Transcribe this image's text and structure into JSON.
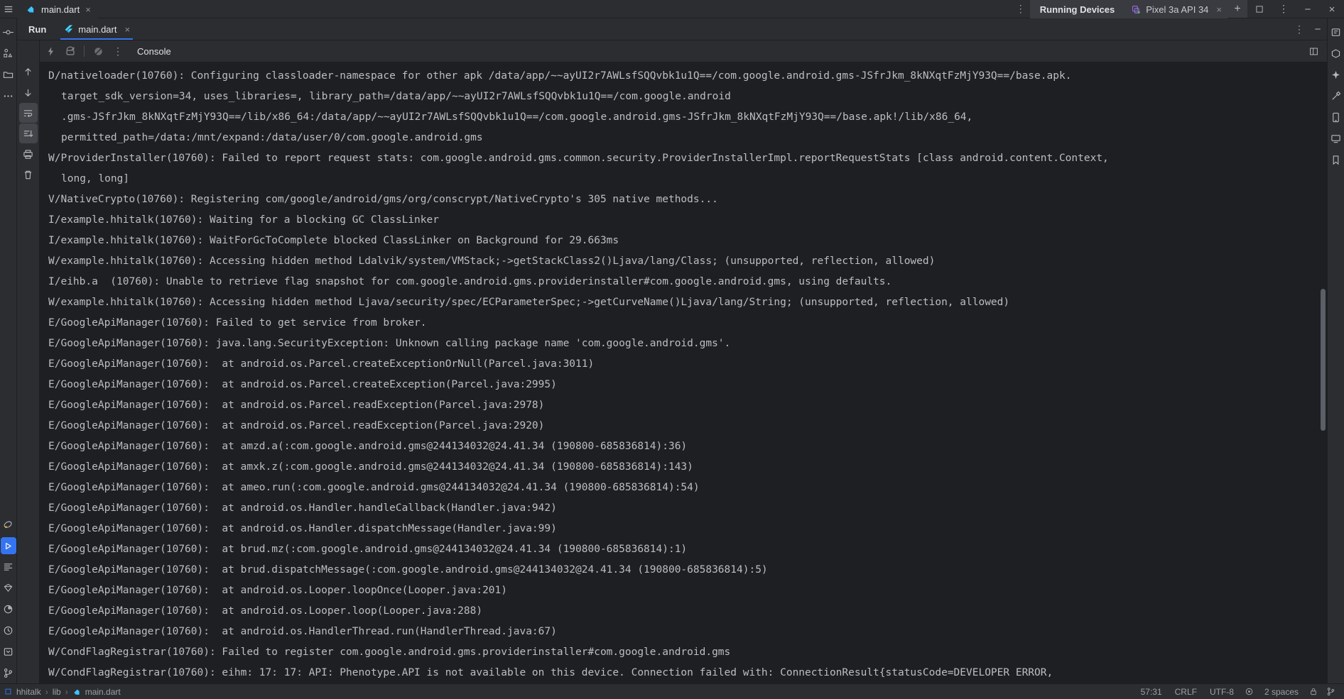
{
  "titlebar": {
    "file_tab": {
      "label": "main.dart",
      "icon": "dart-icon",
      "close": "×"
    },
    "kebab": "⋮",
    "running_devices_label": "Running Devices",
    "device_tab": {
      "label": "Pixel 3a API 34",
      "icon": "device-icon",
      "close": "×"
    },
    "add_device": "+",
    "window_controls": {
      "restore": "❐",
      "more": "⋮",
      "minimize": "─",
      "close": "✕"
    }
  },
  "left_rail": {
    "items": [
      {
        "name": "commit-icon",
        "glyph": "⊖"
      },
      {
        "name": "structure-icon",
        "glyph": "□"
      },
      {
        "name": "project-folder-icon",
        "glyph": "❑"
      },
      {
        "name": "more-tools-icon",
        "glyph": "⋯"
      },
      {
        "name": "device-manager-icon",
        "glyph": "⬚"
      },
      {
        "name": "run-icon",
        "glyph": "▶"
      },
      {
        "name": "terminal-icon",
        "glyph": "≡"
      },
      {
        "name": "flutter-outline-icon",
        "glyph": "◇"
      },
      {
        "name": "profiler-icon",
        "glyph": "◔"
      },
      {
        "name": "todo-icon",
        "glyph": "①"
      },
      {
        "name": "problems-icon",
        "glyph": "⊘"
      },
      {
        "name": "version-control-icon",
        "glyph": "⑂"
      }
    ]
  },
  "right_rail": {
    "items": [
      {
        "name": "notifications-icon",
        "glyph": "☰"
      },
      {
        "name": "gradle-icon",
        "glyph": "⬡"
      },
      {
        "name": "ai-assistant-icon",
        "glyph": "✦"
      },
      {
        "name": "build-icon",
        "glyph": "⚒"
      },
      {
        "name": "device-file-explorer-icon",
        "glyph": "❑"
      },
      {
        "name": "emulator-icon",
        "glyph": "⬛"
      },
      {
        "name": "bookmarks-icon",
        "glyph": "⧉"
      }
    ]
  },
  "run_window": {
    "title": "Run",
    "tab": {
      "label": "main.dart",
      "icon": "flutter-icon",
      "close": "×"
    },
    "settings_icon": "⋮",
    "hide_icon": "─"
  },
  "console_toolbar": {
    "items": [
      {
        "name": "rerun-icon",
        "glyph": "⚡",
        "selected": false
      },
      {
        "name": "hot-reload-icon",
        "glyph": "↺",
        "selected": false
      },
      {
        "name": "stop-icon",
        "glyph": "●",
        "selected": false
      },
      {
        "name": "more-actions-icon",
        "glyph": "⋮",
        "selected": false
      }
    ],
    "console_tab_label": "Console",
    "expand_icon": "❐",
    "side_items": [
      {
        "name": "scroll-up-icon",
        "glyph": "↑",
        "selected": false
      },
      {
        "name": "scroll-down-icon",
        "glyph": "↓",
        "selected": false
      },
      {
        "name": "soft-wrap-icon",
        "glyph": "↵",
        "selected": true
      },
      {
        "name": "scroll-to-end-icon",
        "glyph": "⇣",
        "selected": true
      },
      {
        "name": "print-icon",
        "glyph": "⎙",
        "selected": false
      },
      {
        "name": "clear-all-icon",
        "glyph": "Ὕ1",
        "selected": false
      }
    ]
  },
  "console": {
    "lines": [
      {
        "text": "D/nativeloader(10760): Configuring classloader-namespace for other apk /data/app/~~ayUI2r7AWLsfSQQvbk1u1Q==/com.google.android.gms-JSfrJkm_8kNXqtFzMjY93Q==/base.apk.",
        "cont": false
      },
      {
        "text": "target_sdk_version=34, uses_libraries=, library_path=/data/app/~~ayUI2r7AWLsfSQQvbk1u1Q==/com.google.android",
        "cont": true
      },
      {
        "text": ".gms-JSfrJkm_8kNXqtFzMjY93Q==/lib/x86_64:/data/app/~~ayUI2r7AWLsfSQQvbk1u1Q==/com.google.android.gms-JSfrJkm_8kNXqtFzMjY93Q==/base.apk!/lib/x86_64,",
        "cont": true
      },
      {
        "text": "permitted_path=/data:/mnt/expand:/data/user/0/com.google.android.gms",
        "cont": true
      },
      {
        "text": "W/ProviderInstaller(10760): Failed to report request stats: com.google.android.gms.common.security.ProviderInstallerImpl.reportRequestStats [class android.content.Context,",
        "cont": false
      },
      {
        "text": "long, long]",
        "cont": true
      },
      {
        "text": "V/NativeCrypto(10760): Registering com/google/android/gms/org/conscrypt/NativeCrypto's 305 native methods...",
        "cont": false
      },
      {
        "text": "I/example.hhitalk(10760): Waiting for a blocking GC ClassLinker",
        "cont": false
      },
      {
        "text": "I/example.hhitalk(10760): WaitForGcToComplete blocked ClassLinker on Background for 29.663ms",
        "cont": false
      },
      {
        "text": "W/example.hhitalk(10760): Accessing hidden method Ldalvik/system/VMStack;->getStackClass2()Ljava/lang/Class; (unsupported, reflection, allowed)",
        "cont": false
      },
      {
        "text": "I/eihb.a  (10760): Unable to retrieve flag snapshot for com.google.android.gms.providerinstaller#com.google.android.gms, using defaults.",
        "cont": false
      },
      {
        "text": "W/example.hhitalk(10760): Accessing hidden method Ljava/security/spec/ECParameterSpec;->getCurveName()Ljava/lang/String; (unsupported, reflection, allowed)",
        "cont": false
      },
      {
        "text": "E/GoogleApiManager(10760): Failed to get service from broker.",
        "cont": false
      },
      {
        "text": "E/GoogleApiManager(10760): java.lang.SecurityException: Unknown calling package name 'com.google.android.gms'.",
        "cont": false
      },
      {
        "text": "E/GoogleApiManager(10760):  at android.os.Parcel.createExceptionOrNull(Parcel.java:3011)",
        "cont": false
      },
      {
        "text": "E/GoogleApiManager(10760):  at android.os.Parcel.createException(Parcel.java:2995)",
        "cont": false
      },
      {
        "text": "E/GoogleApiManager(10760):  at android.os.Parcel.readException(Parcel.java:2978)",
        "cont": false
      },
      {
        "text": "E/GoogleApiManager(10760):  at android.os.Parcel.readException(Parcel.java:2920)",
        "cont": false
      },
      {
        "text": "E/GoogleApiManager(10760):  at amzd.a(:com.google.android.gms@244134032@24.41.34 (190800-685836814):36)",
        "cont": false
      },
      {
        "text": "E/GoogleApiManager(10760):  at amxk.z(:com.google.android.gms@244134032@24.41.34 (190800-685836814):143)",
        "cont": false
      },
      {
        "text": "E/GoogleApiManager(10760):  at ameo.run(:com.google.android.gms@244134032@24.41.34 (190800-685836814):54)",
        "cont": false
      },
      {
        "text": "E/GoogleApiManager(10760):  at android.os.Handler.handleCallback(Handler.java:942)",
        "cont": false
      },
      {
        "text": "E/GoogleApiManager(10760):  at android.os.Handler.dispatchMessage(Handler.java:99)",
        "cont": false
      },
      {
        "text": "E/GoogleApiManager(10760):  at brud.mz(:com.google.android.gms@244134032@24.41.34 (190800-685836814):1)",
        "cont": false
      },
      {
        "text": "E/GoogleApiManager(10760):  at brud.dispatchMessage(:com.google.android.gms@244134032@24.41.34 (190800-685836814):5)",
        "cont": false
      },
      {
        "text": "E/GoogleApiManager(10760):  at android.os.Looper.loopOnce(Looper.java:201)",
        "cont": false
      },
      {
        "text": "E/GoogleApiManager(10760):  at android.os.Looper.loop(Looper.java:288)",
        "cont": false
      },
      {
        "text": "E/GoogleApiManager(10760):  at android.os.HandlerThread.run(HandlerThread.java:67)",
        "cont": false
      },
      {
        "text": "W/CondFlagRegistrar(10760): Failed to register com.google.android.gms.providerinstaller#com.google.android.gms",
        "cont": false
      },
      {
        "text": "W/CondFlagRegistrar(10760): eihm: 17: 17: API: Phenotype.API is not available on this device. Connection failed with: ConnectionResult{statusCode=DEVELOPER ERROR,",
        "cont": false
      }
    ]
  },
  "status_bar": {
    "breadcrumb": [
      {
        "label": "hhitalk",
        "icon": "module-icon"
      },
      {
        "label": "lib",
        "icon": ""
      },
      {
        "label": "main.dart",
        "icon": "dart-icon"
      }
    ],
    "separator": "›",
    "caret_position": "57:31",
    "line_separator": "CRLF",
    "encoding": "UTF-8",
    "indent": "2 spaces",
    "lock_icon": "⚿",
    "branch_icon": "⑂",
    "inspection_icon": "◎"
  },
  "colors": {
    "accent": "#3574f0",
    "bg": "#2b2d30",
    "console_bg": "#1e1f22",
    "text": "#bcbec4",
    "device_icon": "#a371f7",
    "online_dot": "#5fb760"
  }
}
